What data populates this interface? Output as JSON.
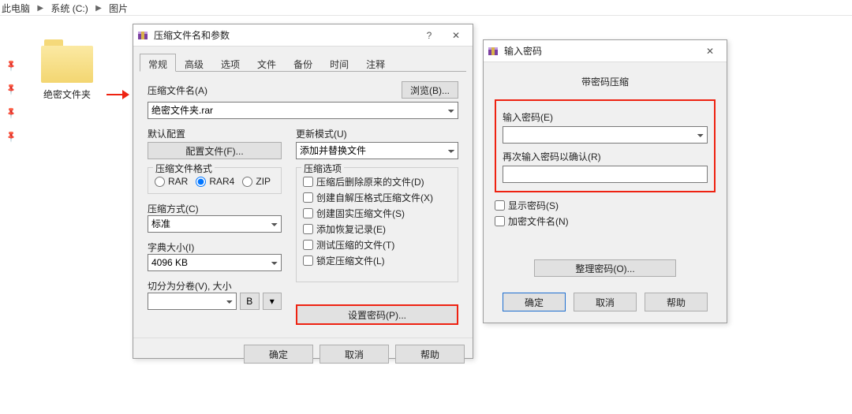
{
  "breadcrumb": {
    "a": "此电脑",
    "b": "系统 (C:)",
    "c": "图片"
  },
  "folder": {
    "name": "绝密文件夹"
  },
  "rar": {
    "title": "压缩文件名和参数",
    "tabs": [
      "常规",
      "高级",
      "选项",
      "文件",
      "备份",
      "时间",
      "注释"
    ],
    "filename_label": "压缩文件名(A)",
    "browse": "浏览(B)...",
    "filename_value": "绝密文件夹.rar",
    "default_cfg_label": "默认配置",
    "config_btn": "配置文件(F)...",
    "update_mode_label": "更新模式(U)",
    "update_mode_value": "添加并替换文件",
    "format_group": "压缩文件格式",
    "fmt_rar": "RAR",
    "fmt_rar4": "RAR4",
    "fmt_zip": "ZIP",
    "options_group": "压缩选项",
    "opt1": "压缩后删除原来的文件(D)",
    "opt2": "创建自解压格式压缩文件(X)",
    "opt3": "创建固实压缩文件(S)",
    "opt4": "添加恢复记录(E)",
    "opt5": "测试压缩的文件(T)",
    "opt6": "锁定压缩文件(L)",
    "method_label": "压缩方式(C)",
    "method_value": "标准",
    "dict_label": "字典大小(I)",
    "dict_value": "4096 KB",
    "split_label": "切分为分卷(V), 大小",
    "split_unit": "B",
    "set_password": "设置密码(P)...",
    "ok": "确定",
    "cancel": "取消",
    "help": "帮助"
  },
  "pwd": {
    "title": "输入密码",
    "subtitle": "带密码压缩",
    "enter_label": "输入密码(E)",
    "confirm_label": "再次输入密码以确认(R)",
    "show_pwd": "显示密码(S)",
    "encrypt_names": "加密文件名(N)",
    "organize": "整理密码(O)...",
    "ok": "确定",
    "cancel": "取消",
    "help": "帮助"
  }
}
